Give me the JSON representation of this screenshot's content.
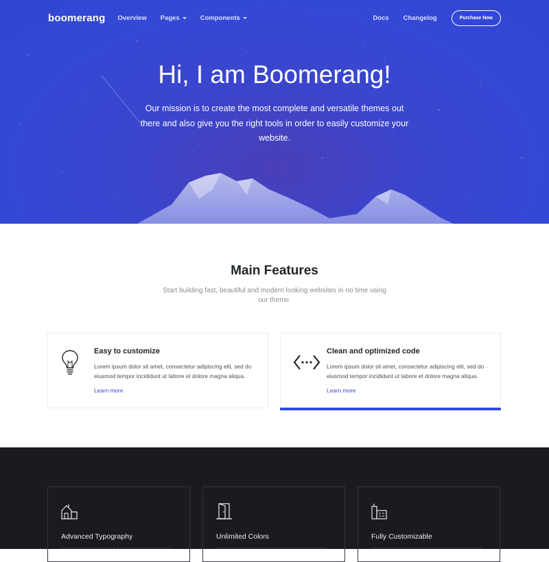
{
  "nav": {
    "brand": "boomerang",
    "links": [
      "Overview",
      "Pages",
      "Components"
    ],
    "right_links": [
      "Docs",
      "Changelog"
    ],
    "purchase_label": "Purchase Now"
  },
  "hero": {
    "title": "Hi, I am Boomerang!",
    "text": "Our mission is to create the most complete and versatile themes out there and also give you the right tools in order to easily customize your website."
  },
  "features": {
    "title": "Main Features",
    "subtitle": "Start building fast, beautiful and modern looking websites in no time using our theme.",
    "cards": [
      {
        "icon": "lightbulb-icon",
        "title": "Easy to customize",
        "text": "Lorem ipsum dolor sit amet, consectetur adipiscing elit, sed do eiusmod tempor incididunt ut labore et dolore magna aliqua.",
        "link": "Learn more"
      },
      {
        "icon": "code-icon",
        "title": "Clean and optimized code",
        "text": "Lorem ipsum dolor sit amet, consectetur adipiscing elit, sed do eiusmod tempor incididunt ut labore et dolore magna aliqua.",
        "link": "Learn more"
      }
    ]
  },
  "dark_cards": [
    {
      "icon": "house-icon",
      "title": "Advanced Typography"
    },
    {
      "icon": "door-icon",
      "title": "Unlimited Colors"
    },
    {
      "icon": "buildings-icon",
      "title": "Fully Customizable"
    }
  ],
  "colors": {
    "hero_blue": "#3349d6",
    "accent": "#3348db",
    "dark_bg": "#1a1b1f"
  }
}
